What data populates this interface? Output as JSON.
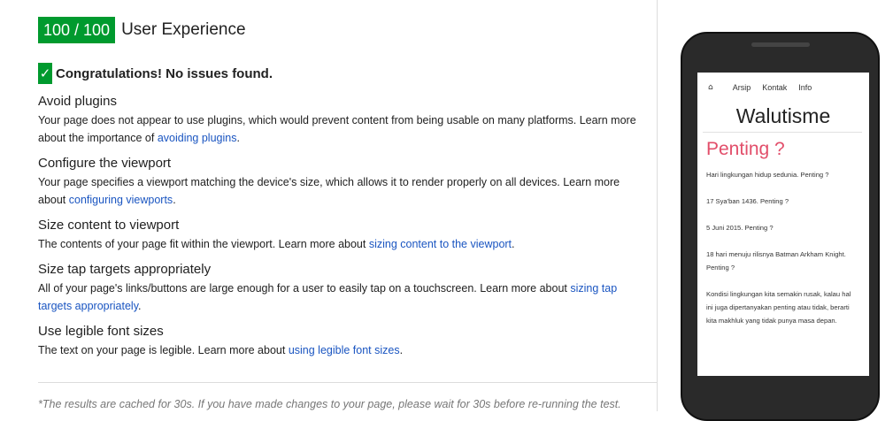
{
  "score": "100 / 100",
  "section_title": "User Experience",
  "congrats": "Congratulations! No issues found.",
  "rules": [
    {
      "title": "Avoid plugins",
      "desc": "Your page does not appear to use plugins, which would prevent content from being usable on many platforms. Learn more about the importance of ",
      "link": "avoiding plugins",
      "after": "."
    },
    {
      "title": "Configure the viewport",
      "desc": "Your page specifies a viewport matching the device's size, which allows it to render properly on all devices. Learn more about ",
      "link": "configuring viewports",
      "after": "."
    },
    {
      "title": "Size content to viewport",
      "desc": "The contents of your page fit within the viewport. Learn more about ",
      "link": "sizing content to the viewport",
      "after": "."
    },
    {
      "title": "Size tap targets appropriately",
      "desc": "All of your page's links/buttons are large enough for a user to easily tap on a touchscreen. Learn more about ",
      "link": "sizing tap targets appropriately",
      "after": "."
    },
    {
      "title": "Use legible font sizes",
      "desc": "The text on your page is legible. Learn more about ",
      "link": "using legible font sizes",
      "after": "."
    }
  ],
  "footer_note": "*The results are cached for 30s. If you have made changes to your page, please wait for 30s before re-running the test.",
  "phone": {
    "nav": [
      "Arsip",
      "Kontak",
      "Info"
    ],
    "home_icon": "home-icon",
    "site_title": "Walutisme",
    "post_title": "Penting ?",
    "lines": [
      "Hari lingkungan hidup sedunia. Penting ?",
      "17 Sya'ban 1436. Penting ?",
      "5 Juni 2015. Penting ?",
      "18 hari menuju rilisnya Batman Arkham Knight. Penting ?",
      "Kondisi lingkungan kita semakin rusak, kalau hal ini juga dipertanyakan penting atau tidak, berarti kita makhluk yang tidak punya masa depan."
    ]
  },
  "colors": {
    "score_green": "#009a2e",
    "link_blue": "#1a55c1",
    "post_title_pink": "#e24e6a"
  }
}
